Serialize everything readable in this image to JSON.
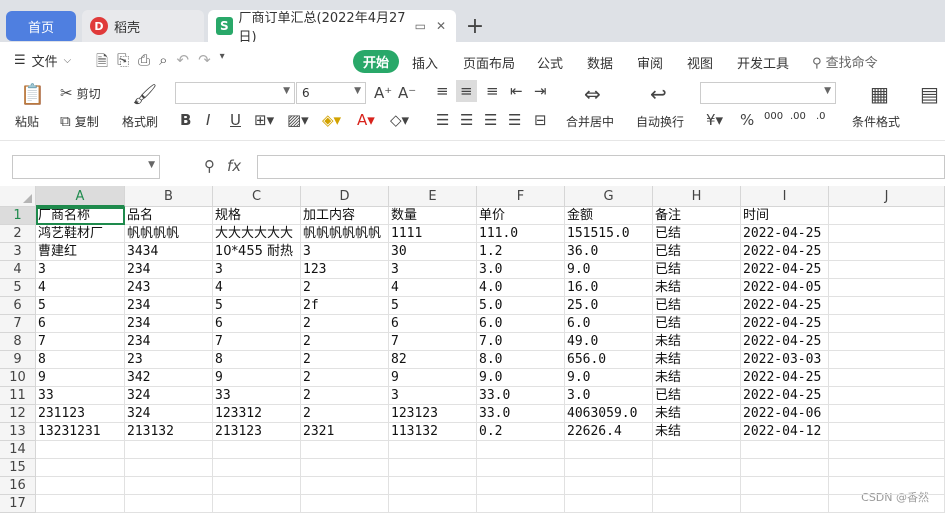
{
  "tabs": {
    "home": "首页",
    "daoke": "稻壳",
    "active": "厂商订单汇总(2022年4月27日)"
  },
  "menu": {
    "file": "文件",
    "items": [
      "开始",
      "插入",
      "页面布局",
      "公式",
      "数据",
      "审阅",
      "视图",
      "开发工具"
    ],
    "search": "查找命令"
  },
  "ribbon": {
    "paste": "粘贴",
    "cut": "剪切",
    "copy": "复制",
    "format_painter": "格式刷",
    "font_size": "6",
    "merge_center": "合并居中",
    "wrap_text": "自动换行",
    "conditional_format": "条件格式"
  },
  "formula_bar": {
    "fx": "fx",
    "value": ""
  },
  "sheet": {
    "columns": [
      "A",
      "B",
      "C",
      "D",
      "E",
      "F",
      "G",
      "H",
      "I",
      "J"
    ],
    "rows": [
      [
        "厂商名称",
        "品名",
        "规格",
        "加工内容",
        "数量",
        "单价",
        "金额",
        "备注",
        "时间",
        ""
      ],
      [
        "鸿艺鞋材厂",
        "帆帆帆帆",
        "大大大大大大",
        "帆帆帆帆帆帆",
        "1111",
        "111.0",
        "151515.0",
        "已结",
        "2022-04-25",
        ""
      ],
      [
        "曹建红",
        "3434",
        "10*455 耐热",
        "3",
        "30",
        "1.2",
        "36.0",
        "已结",
        "2022-04-25",
        ""
      ],
      [
        "3",
        "234",
        "3",
        "123",
        "3",
        "3.0",
        "9.0",
        "已结",
        "2022-04-25",
        ""
      ],
      [
        "4",
        "243",
        "4",
        "2",
        "4",
        "4.0",
        "16.0",
        "未结",
        "2022-04-05",
        ""
      ],
      [
        "5",
        "234",
        "5",
        "2f",
        "5",
        "5.0",
        "25.0",
        "已结",
        "2022-04-25",
        ""
      ],
      [
        "6",
        "234",
        "6",
        "2",
        "6",
        "6.0",
        "6.0",
        "已结",
        "2022-04-25",
        ""
      ],
      [
        "7",
        "234",
        "7",
        "2",
        "7",
        "7.0",
        "49.0",
        "未结",
        "2022-04-25",
        ""
      ],
      [
        "8",
        "23",
        "8",
        "2",
        "82",
        "8.0",
        "656.0",
        "未结",
        "2022-03-03",
        ""
      ],
      [
        "9",
        "342",
        "9",
        "2",
        "9",
        "9.0",
        "9.0",
        "未结",
        "2022-04-25",
        ""
      ],
      [
        "33",
        "324",
        "33",
        "2",
        "3",
        "33.0",
        "3.0",
        "已结",
        "2022-04-25",
        ""
      ],
      [
        "231123",
        "324",
        "123312",
        "2",
        "123123",
        "33.0",
        "4063059.0",
        "未结",
        "2022-04-06",
        ""
      ],
      [
        "13231231",
        "213132",
        "213123",
        "2321",
        "113132",
        "0.2",
        "22626.4",
        "未结",
        "2022-04-12",
        ""
      ],
      [
        "",
        "",
        "",
        "",
        "",
        "",
        "",
        "",
        "",
        ""
      ],
      [
        "",
        "",
        "",
        "",
        "",
        "",
        "",
        "",
        "",
        ""
      ],
      [
        "",
        "",
        "",
        "",
        "",
        "",
        "",
        "",
        "",
        ""
      ],
      [
        "",
        "",
        "",
        "",
        "",
        "",
        "",
        "",
        "",
        ""
      ]
    ],
    "row_numbers": [
      "1",
      "2",
      "3",
      "4",
      "5",
      "6",
      "7",
      "8",
      "9",
      "10",
      "11",
      "12",
      "13",
      "14",
      "15",
      "16",
      "17"
    ]
  },
  "watermark": "CSDN @香然",
  "colors": {
    "accent": "#29a869",
    "home_tab": "#4f7fe0",
    "selection": "#1e8a4c"
  }
}
